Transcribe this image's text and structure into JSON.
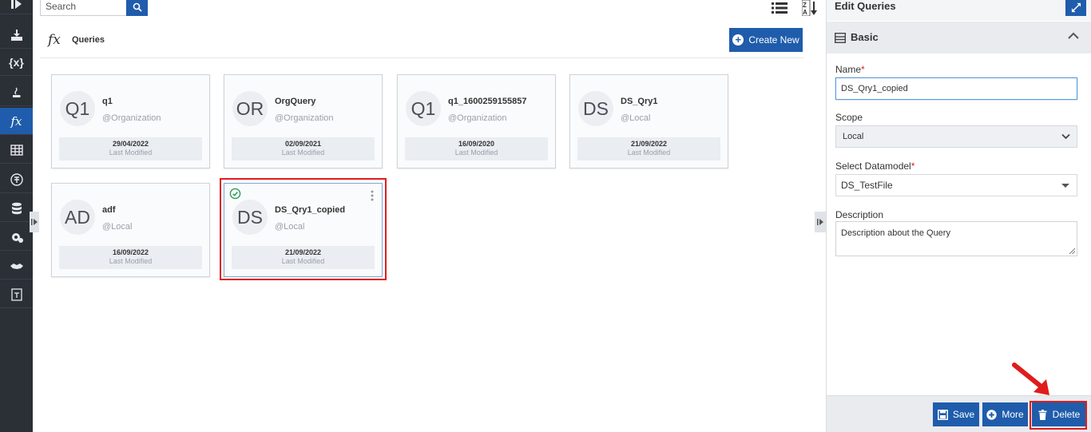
{
  "sidebar": {
    "icons": [
      "toggle-panel-icon",
      "data-import-icon",
      "variables-icon",
      "java-icon",
      "functions-icon",
      "table-icon",
      "currency-icon",
      "database-icon",
      "settings-icon",
      "handshake-icon",
      "text-file-icon"
    ],
    "variables_label": "{x}",
    "functions_label": "fx"
  },
  "toolbar": {
    "search_placeholder": "Search"
  },
  "header": {
    "fx_label": "fx",
    "title": "Queries",
    "create_label": "Create New"
  },
  "cards": [
    {
      "initials": "Q1",
      "name": "q1",
      "scope": "@Organization",
      "date": "29/04/2022",
      "sub": "Last Modified"
    },
    {
      "initials": "OR",
      "name": "OrgQuery",
      "scope": "@Organization",
      "date": "02/09/2021",
      "sub": "Last Modified"
    },
    {
      "initials": "Q1",
      "name": "q1_1600259155857",
      "scope": "@Organization",
      "date": "16/09/2020",
      "sub": "Last Modified"
    },
    {
      "initials": "DS",
      "name": "DS_Qry1",
      "scope": "@Local",
      "date": "21/09/2022",
      "sub": "Last Modified"
    },
    {
      "initials": "AD",
      "name": "adf",
      "scope": "@Local",
      "date": "16/09/2022",
      "sub": "Last Modified"
    },
    {
      "initials": "DS",
      "name": "DS_Qry1_copied",
      "scope": "@Local",
      "date": "21/09/2022",
      "sub": "Last Modified",
      "selected": true
    }
  ],
  "panel": {
    "title": "Edit Queries",
    "section": "Basic",
    "name_label": "Name",
    "name_value": "DS_Qry1_copied",
    "scope_label": "Scope",
    "scope_value": "Local",
    "datamodel_label": "Select Datamodel",
    "datamodel_value": "DS_TestFile",
    "description_label": "Description",
    "description_value": "Description about the Query",
    "required_mark": "*",
    "save_label": "Save",
    "more_label": "More",
    "delete_label": "Delete"
  },
  "colors": {
    "accent": "#1f5cab",
    "highlight": "#e01c1c",
    "rail": "#2b2f36",
    "success": "#2e9a5a"
  }
}
